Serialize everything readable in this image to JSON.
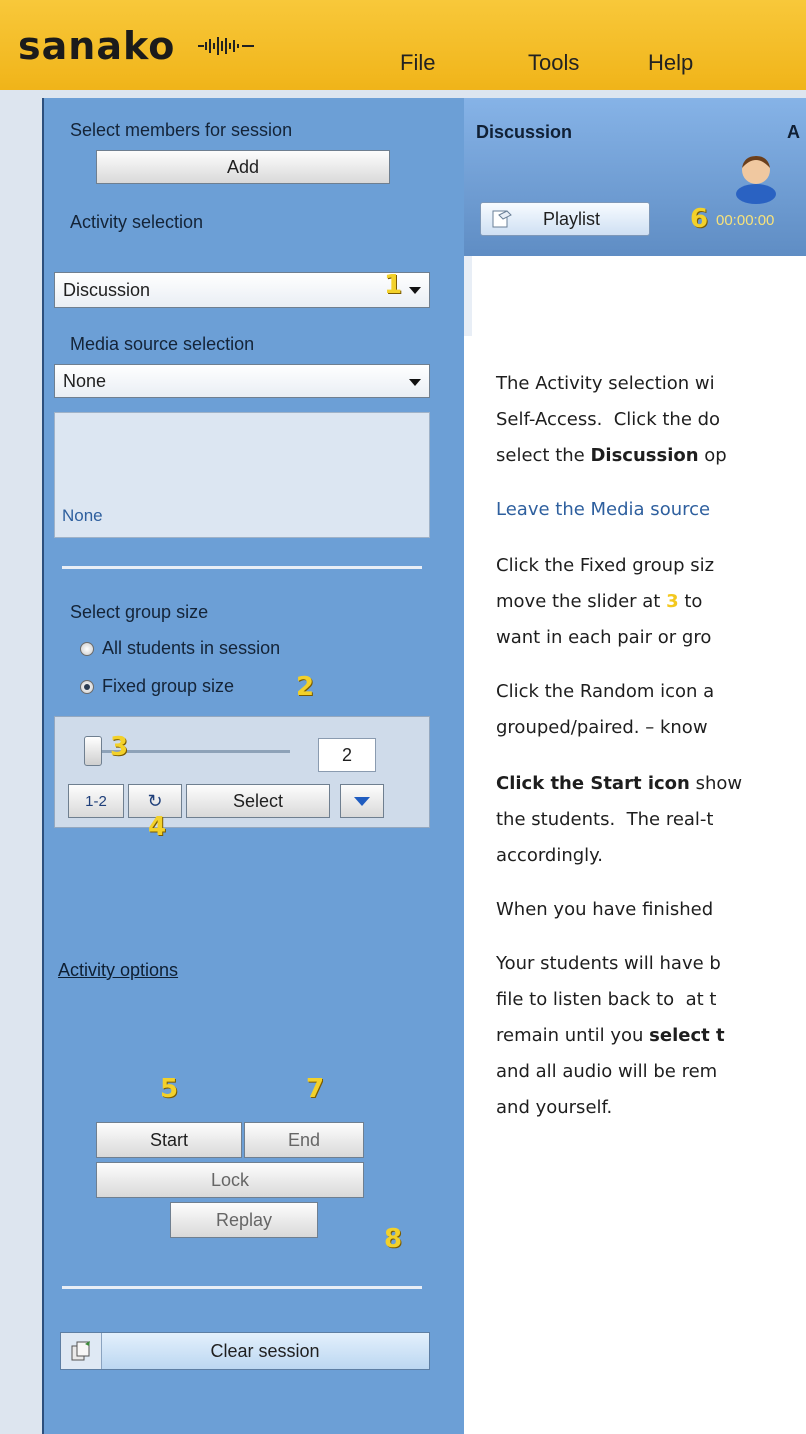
{
  "app": {
    "logo": "sanako",
    "menu": [
      "File",
      "Tools",
      "Help"
    ]
  },
  "left": {
    "select_members_label": "Select members for session",
    "add_button": "Add",
    "activity_label": "Activity selection",
    "activity_value": "Discussion",
    "media_label": "Media source selection",
    "media_value": "None",
    "media_preview": "None",
    "group_size_label": "Select group size",
    "radio_all": "All students in session",
    "radio_fixed": "Fixed group size",
    "group_size_value": "2",
    "one_two_button": "1-2",
    "random_button": "↻",
    "select_button": "Select",
    "activity_options_link": "Activity options",
    "start_button": "Start",
    "end_button": "End",
    "lock_button": "Lock",
    "replay_button": "Replay",
    "clear_session_button": "Clear session"
  },
  "right": {
    "header_title": "Discussion",
    "header_partial": "A",
    "playlist_tab": "Playlist",
    "timer": "00:00:00"
  },
  "markers": [
    "1",
    "2",
    "3",
    "4",
    "5",
    "6",
    "7",
    "8"
  ],
  "instructions": {
    "line1": "The Activity selection wi",
    "line2": "Self-Access.  Click the do",
    "line3_prefix": "select the ",
    "line3_bold": "Discussion",
    "line3_suffix": " op",
    "line4": "Leave the Media source",
    "line5": "Click the Fixed group siz",
    "line6_prefix": "move the slider at ",
    "line6_suffix": " to",
    "line7": "want in each pair or gro",
    "line8": "Click the Random icon a",
    "line9": "grouped/paired. – know",
    "line10_bold": "Click the Start icon",
    "line10_suffix": " show",
    "line11": "the students.  The real-t",
    "line12": "accordingly.",
    "line13": "When you have finished",
    "line14": "Your students will have b",
    "line15": "file to listen back to  at t",
    "line16_prefix": "remain until you ",
    "line16_bold": "select t",
    "line17": "and all audio will be rem",
    "line18": "and yourself."
  },
  "colors": {
    "topbar": "#f2b71f",
    "left_panel": "#6c9fd6",
    "marker": "#f3d12a",
    "media_link": "#2e5f9e"
  }
}
